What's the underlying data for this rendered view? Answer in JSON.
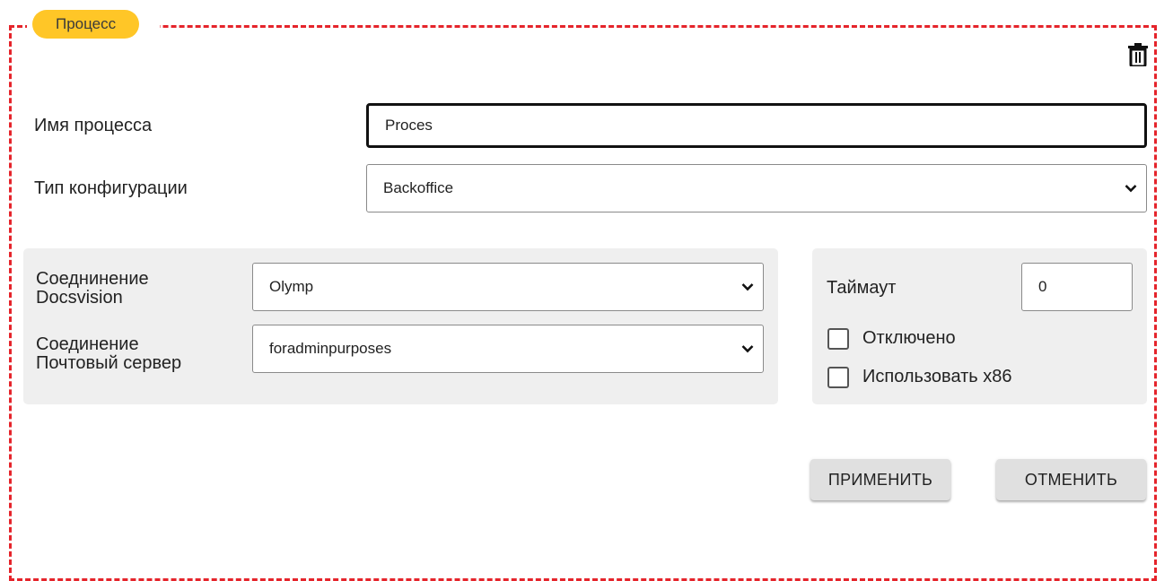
{
  "section": {
    "badge_label": "Процесс"
  },
  "form": {
    "process_name_label": "Имя процесса",
    "process_name_value": "Proces",
    "config_type_label": "Тип конфигурации",
    "config_type_value": "Backoffice"
  },
  "connections": {
    "docsvision_label_line1": "Соеднинение",
    "docsvision_label_line2": "Docsvision",
    "docsvision_value": "Olymp",
    "mail_label_line1": "Соединение",
    "mail_label_line2": "Почтовый сервер",
    "mail_value": "foradminpurposes"
  },
  "options": {
    "timeout_label": "Таймаут",
    "timeout_value": "0",
    "disabled_label": "Отключено",
    "disabled_checked": false,
    "x86_label": "Использовать x86",
    "x86_checked": false
  },
  "actions": {
    "apply_label": "ПРИМЕНИТЬ",
    "cancel_label": "ОТМЕНИТЬ"
  },
  "icons": {
    "delete": "trash-icon",
    "dropdown": "chevron-down-icon"
  },
  "colors": {
    "frame_border": "#e5242b",
    "badge_bg": "#ffc627",
    "panel_bg": "#efefef",
    "button_bg": "#e0e0e0"
  }
}
